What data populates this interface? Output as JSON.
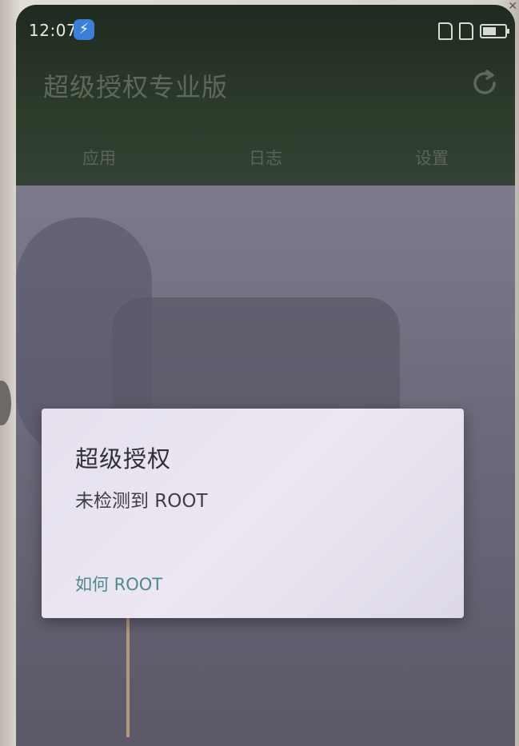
{
  "status_bar": {
    "time": "12:07",
    "app_icon": "shield-bolt-icon",
    "sim_icons": [
      "sim-card-icon",
      "sim-card-icon"
    ],
    "battery_icon": "battery-icon"
  },
  "app": {
    "title": "超级授权专业版",
    "refresh_icon": "refresh-icon",
    "tabs": [
      {
        "label": "应用"
      },
      {
        "label": "日志"
      },
      {
        "label": "设置"
      }
    ]
  },
  "dialog": {
    "title": "超级授权",
    "message": "未检测到 ROOT",
    "action_label": "如何 ROOT"
  },
  "colors": {
    "header_bg": "#2c3a2a",
    "dialog_bg": "#e6e0ee",
    "action_text": "#4d8a90"
  }
}
